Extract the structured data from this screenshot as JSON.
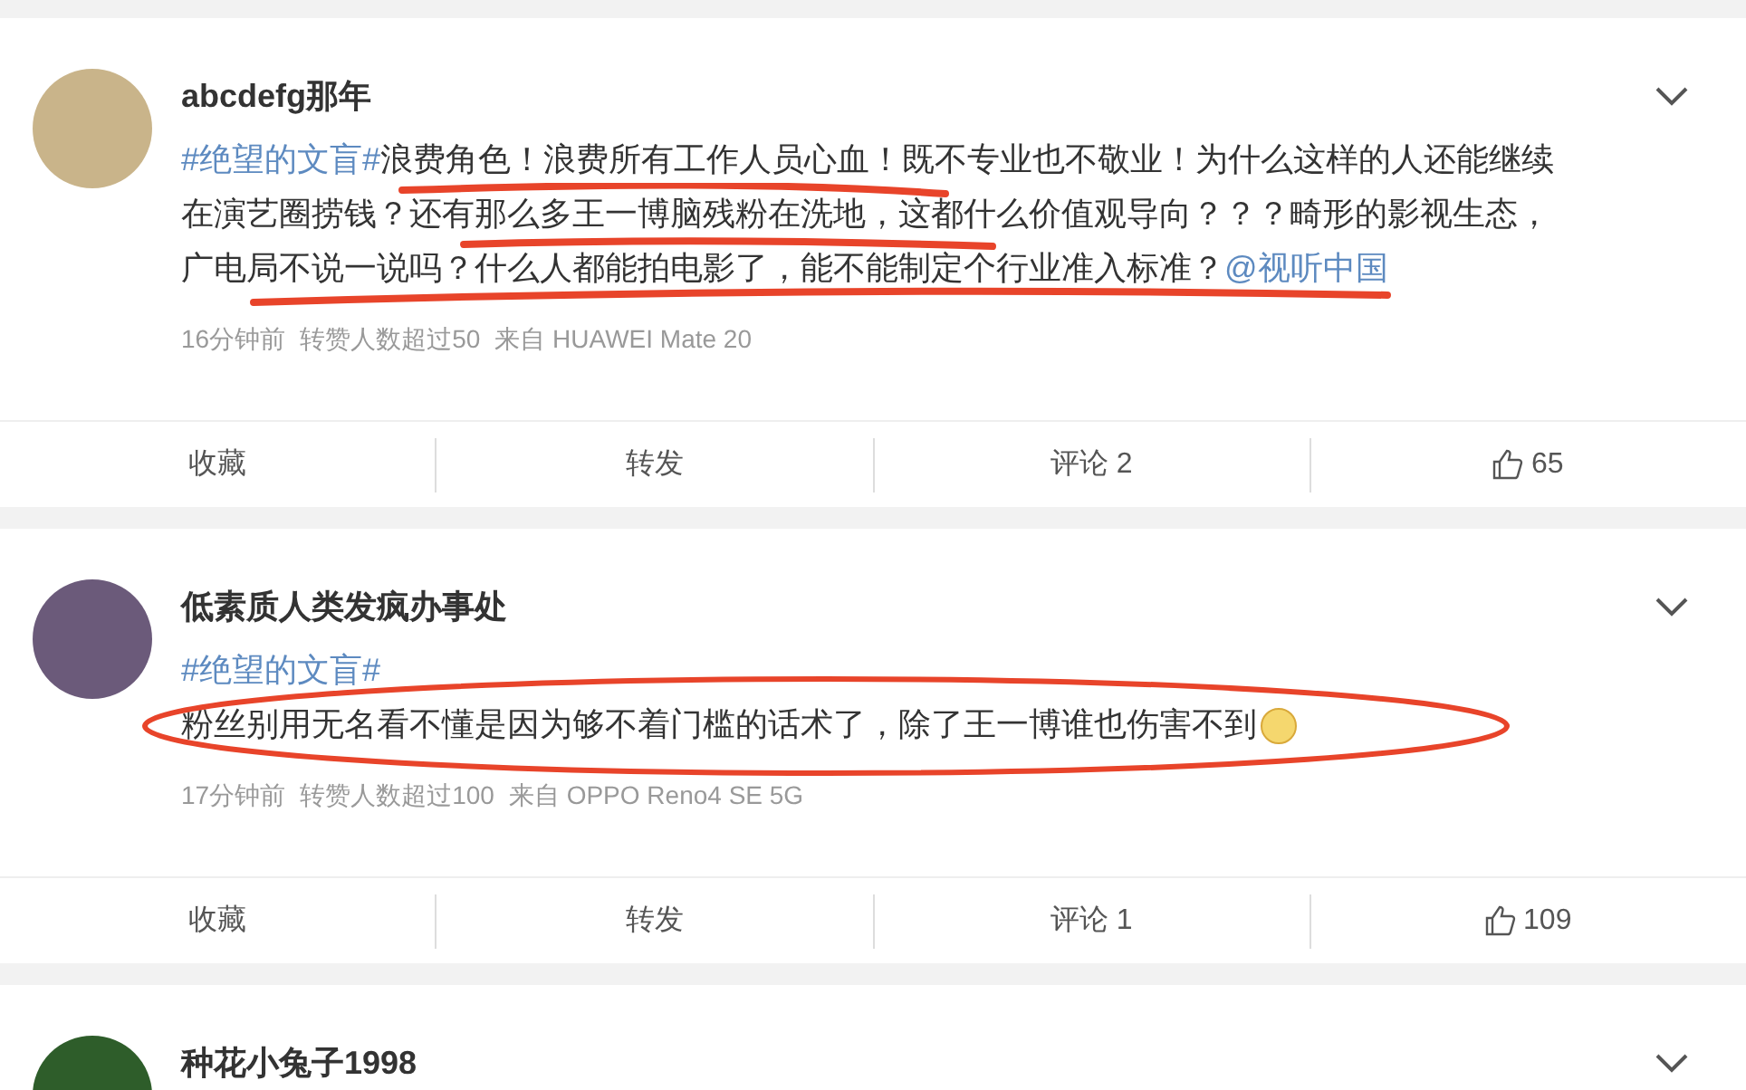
{
  "posts": [
    {
      "author": "abcdefg那年",
      "avatar": {
        "kind": "photo"
      },
      "body": [
        {
          "kind": "link",
          "text": "#绝望的文盲#"
        },
        {
          "kind": "text",
          "text": "浪费角色！浪费所有工作人员心血！既不专业也不敬业！为什么这样的人还能继续在演艺圈捞钱？还有那么多王一博脑残粉在洗地，这都什么价值观导向？？？畸形的影视生态，广电局不说一说吗？什么人都能拍电影了，能不能制定个行业准入标准？"
        },
        {
          "kind": "link",
          "text": "@视听中国"
        }
      ],
      "annotation": {
        "kind": "underline"
      },
      "time": "16分钟前",
      "stats": "转赞人数超过50",
      "source": "来自 HUAWEI Mate 20",
      "actions": {
        "favorite": "收藏",
        "repost": "转发",
        "comment": "评论 2",
        "like": "65"
      }
    },
    {
      "author": "低素质人类发疯办事处",
      "avatar": {
        "kind": "cartoon"
      },
      "hashtag": "#绝望的文盲#",
      "body": [
        {
          "kind": "text",
          "text": "粉丝别用无名看不懂是因为够不着门槛的话术了，除了王一博谁也伤害不到"
        }
      ],
      "emoji": true,
      "annotation": {
        "kind": "ellipse"
      },
      "time": "17分钟前",
      "stats": "转赞人数超过100",
      "source": "来自 OPPO Reno4 SE 5G",
      "actions": {
        "favorite": "收藏",
        "repost": "转发",
        "comment": "评论 1",
        "like": "109"
      }
    },
    {
      "author": "种花小兔子1998",
      "avatar": {
        "kind": "green"
      }
    }
  ]
}
